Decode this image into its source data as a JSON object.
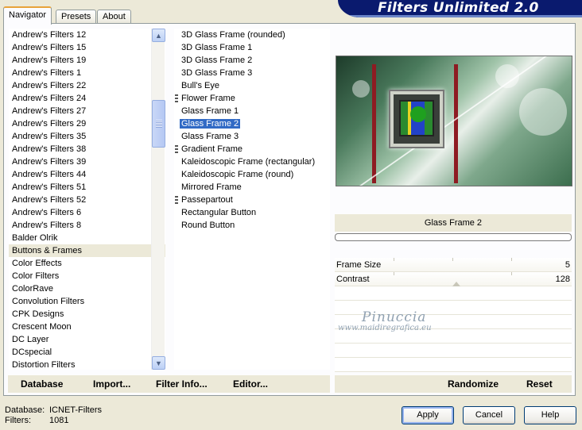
{
  "banner": {
    "title": "Filters Unlimited 2.0"
  },
  "tabs": [
    {
      "label": "Navigator",
      "active": true
    },
    {
      "label": "Presets",
      "active": false
    },
    {
      "label": "About",
      "active": false
    }
  ],
  "categories": [
    "Andrew's Filters 12",
    "Andrew's Filters 15",
    "Andrew's Filters 19",
    "Andrew's Filters 1",
    "Andrew's Filters 22",
    "Andrew's Filters 24",
    "Andrew's Filters 27",
    "Andrew's Filters 29",
    "Andrew's Filters 35",
    "Andrew's Filters 38",
    "Andrew's Filters 39",
    "Andrew's Filters 44",
    "Andrew's Filters 51",
    "Andrew's Filters 52",
    "Andrew's Filters 6",
    "Andrew's Filters 8",
    "Balder Olrik",
    "Buttons & Frames",
    "Color Effects",
    "Color Filters",
    "ColorRave",
    "Convolution Filters",
    "CPK Designs",
    "Crescent Moon",
    "DC Layer",
    "DCspecial",
    "Distortion Filters"
  ],
  "selected_category": "Buttons & Frames",
  "filters": [
    {
      "label": "3D Glass Frame (rounded)",
      "group": false
    },
    {
      "label": "3D Glass Frame 1",
      "group": false
    },
    {
      "label": "3D Glass Frame 2",
      "group": false
    },
    {
      "label": "3D Glass Frame 3",
      "group": false
    },
    {
      "label": "Bull's Eye",
      "group": false
    },
    {
      "label": "Flower Frame",
      "group": true
    },
    {
      "label": "Glass Frame 1",
      "group": false
    },
    {
      "label": "Glass Frame 2",
      "group": false
    },
    {
      "label": "Glass Frame 3",
      "group": false
    },
    {
      "label": "Gradient Frame",
      "group": true
    },
    {
      "label": "Kaleidoscopic Frame (rectangular)",
      "group": false
    },
    {
      "label": "Kaleidoscopic Frame (round)",
      "group": false
    },
    {
      "label": "Mirrored Frame",
      "group": false
    },
    {
      "label": "Passepartout",
      "group": true
    },
    {
      "label": "Rectangular Button",
      "group": false
    },
    {
      "label": "Round Button",
      "group": false
    }
  ],
  "selected_filter": "Glass Frame 2",
  "filter_title": "Glass Frame 2",
  "params": [
    {
      "label": "Frame Size",
      "value": "5"
    },
    {
      "label": "Contrast",
      "value": "128"
    }
  ],
  "watermark": {
    "name": "Pinuccia",
    "url": "www.maidiregrafica.eu"
  },
  "strip": {
    "database": "Database",
    "import": "Import...",
    "filter_info": "Filter Info...",
    "editor": "Editor...",
    "randomize": "Randomize",
    "reset": "Reset"
  },
  "stats": {
    "database_label": "Database:",
    "database_value": "ICNET-Filters",
    "filters_label": "Filters:",
    "filters_value": "1081"
  },
  "buttons": {
    "apply": "Apply",
    "cancel": "Cancel",
    "help": "Help"
  },
  "colors": {
    "banner": "#0a1a6e",
    "selection": "#316ac5",
    "background": "#ece9d8"
  }
}
